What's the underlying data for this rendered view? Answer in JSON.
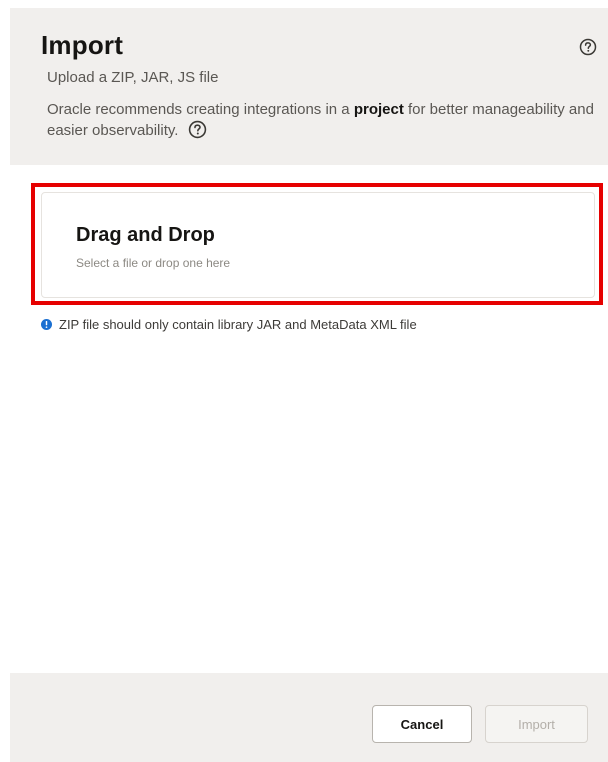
{
  "dialog": {
    "title": "Import",
    "subtitle": "Upload a ZIP, JAR, JS file",
    "recommend_before": "Oracle recommends creating integrations in a ",
    "recommend_link": "project",
    "recommend_after": " for better manageability and easier observability.",
    "help_icon": "question-circle-icon"
  },
  "dropzone": {
    "title": "Drag and Drop",
    "hint": "Select a file or drop one here",
    "highlight_color": "#e60000"
  },
  "info": {
    "icon": "info-icon",
    "text": "ZIP file should only contain library JAR and MetaData XML file",
    "icon_color": "#1a6fd1"
  },
  "footer": {
    "cancel_label": "Cancel",
    "import_label": "Import"
  }
}
